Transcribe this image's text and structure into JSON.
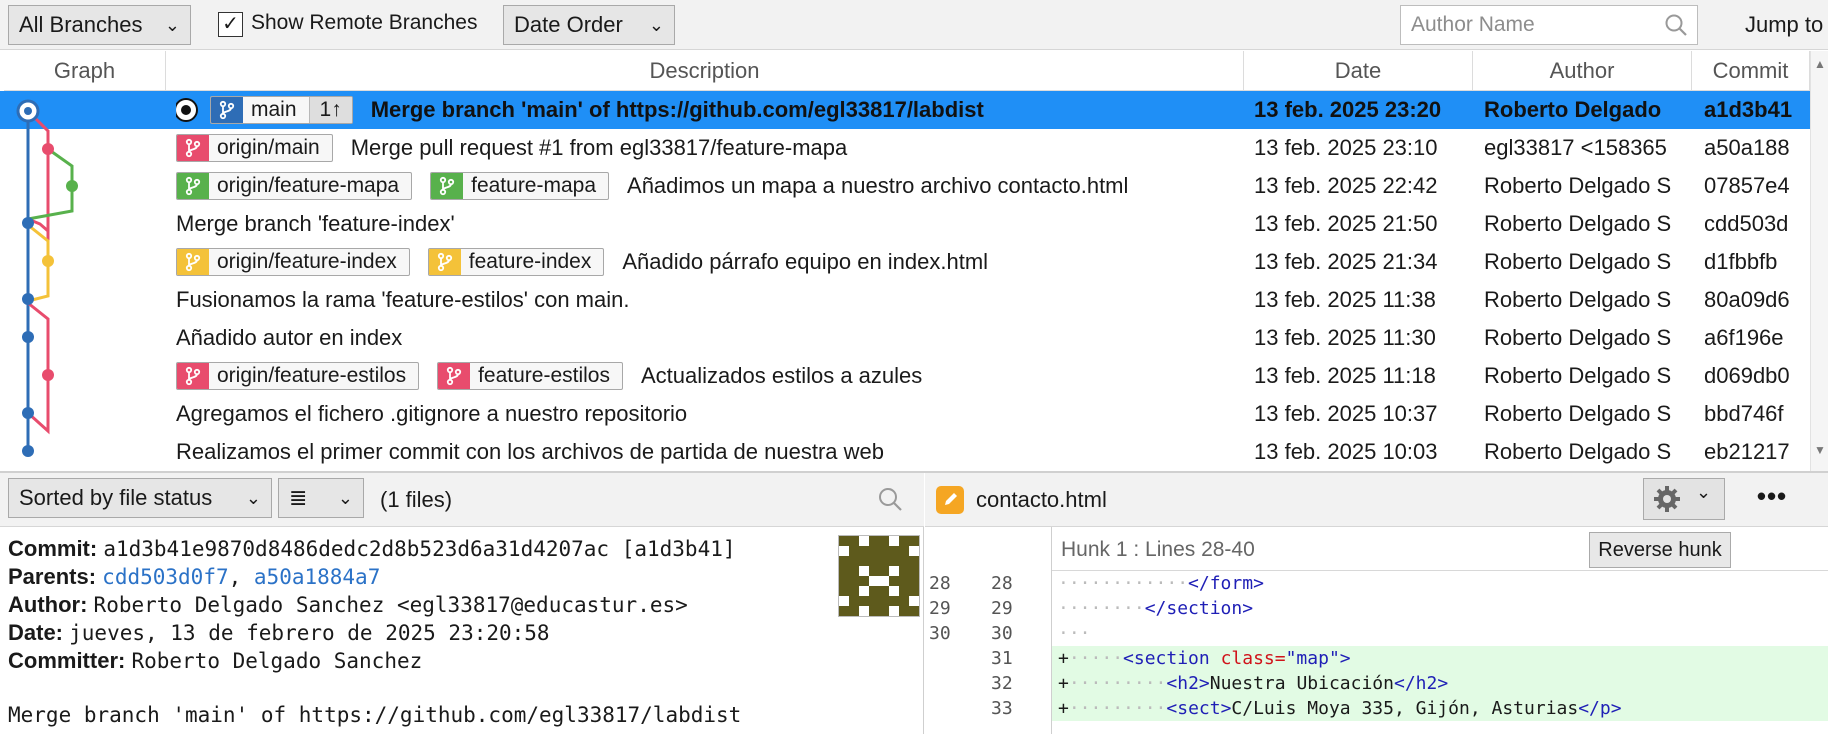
{
  "toolbar": {
    "branches_select": "All Branches",
    "show_remote_label": "Show Remote Branches",
    "show_remote_checked": "✓",
    "order_select": "Date Order",
    "author_search_placeholder": "Author Name",
    "jump_label": "Jump to"
  },
  "columns": {
    "graph": "Graph",
    "description": "Description",
    "date": "Date",
    "author": "Author",
    "commit": "Commit"
  },
  "commits": [
    {
      "badges": [
        {
          "label": "main",
          "color": "blue",
          "count": "1↑"
        }
      ],
      "message": "Merge branch 'main' of https://github.com/egl33817/labdist",
      "date": "13 feb. 2025 23:20",
      "author": "Roberto Delgado",
      "hash": "a1d3b41",
      "selected": true
    },
    {
      "badges": [
        {
          "label": "origin/main",
          "color": "red"
        }
      ],
      "message": "Merge pull request #1 from egl33817/feature-mapa",
      "date": "13 feb. 2025 23:10",
      "author": "egl33817 <158365",
      "hash": "a50a188"
    },
    {
      "badges": [
        {
          "label": "origin/feature-mapa",
          "color": "green"
        },
        {
          "label": "feature-mapa",
          "color": "green"
        }
      ],
      "message": "Añadimos un mapa a nuestro archivo contacto.html",
      "date": "13 feb. 2025 22:42",
      "author": "Roberto Delgado S",
      "hash": "07857e4"
    },
    {
      "badges": [],
      "message": "Merge branch 'feature-index'",
      "date": "13 feb. 2025 21:50",
      "author": "Roberto Delgado S",
      "hash": "cdd503d"
    },
    {
      "badges": [
        {
          "label": "origin/feature-index",
          "color": "yellow"
        },
        {
          "label": "feature-index",
          "color": "yellow"
        }
      ],
      "message": "Añadido párrafo equipo en index.html",
      "date": "13 feb. 2025 21:34",
      "author": "Roberto Delgado S",
      "hash": "d1fbbfb"
    },
    {
      "badges": [],
      "message": "Fusionamos la rama 'feature-estilos' con main.",
      "date": "13 feb. 2025 11:38",
      "author": "Roberto Delgado S",
      "hash": "80a09d6"
    },
    {
      "badges": [],
      "message": "Añadido autor en index",
      "date": "13 feb. 2025 11:30",
      "author": "Roberto Delgado S",
      "hash": "a6f196e"
    },
    {
      "badges": [
        {
          "label": "origin/feature-estilos",
          "color": "red"
        },
        {
          "label": "feature-estilos",
          "color": "red"
        }
      ],
      "message": "Actualizados estilos a azules",
      "date": "13 feb. 2025 11:18",
      "author": "Roberto Delgado S",
      "hash": "d069db0"
    },
    {
      "badges": [],
      "message": "Agregamos el fichero .gitignore a nuestro repositorio",
      "date": "13 feb. 2025 10:37",
      "author": "Roberto Delgado S",
      "hash": "bbd746f"
    },
    {
      "badges": [],
      "message": "Realizamos el primer commit con los archivos de partida de nuestra web",
      "date": "13 feb. 2025 10:03",
      "author": "Roberto Delgado S",
      "hash": "eb21217"
    }
  ],
  "file_pane": {
    "sort_select": "Sorted by file status",
    "view_select": "≣",
    "files_count": "(1 files)"
  },
  "details": {
    "commit_label": "Commit:",
    "commit_value": "a1d3b41e9870d8486dedc2d8b523d6a31d4207ac [a1d3b41]",
    "parents_label": "Parents:",
    "parent_1": "cdd503d0f7",
    "parents_sep": ", ",
    "parent_2": "a50a1884a7",
    "author_label": "Author:",
    "author_value": "Roberto Delgado Sanchez <egl33817@educastur.es>",
    "date_label": "Date:",
    "date_value": "jueves, 13 de febrero de 2025 23:20:58",
    "committer_label": "Committer:",
    "committer_value": "Roberto Delgado Sanchez",
    "message": "Merge branch 'main' of https://github.com/egl33817/labdist"
  },
  "diff": {
    "file_name": "contacto.html",
    "more_label": "•••",
    "hunk_title": "Hunk 1 : Lines 28-40",
    "reverse_label": "Reverse hunk",
    "lines": [
      {
        "old": "28",
        "new": "28",
        "type": "ctx",
        "prefix": "",
        "indent": "············",
        "tag_open": "</form>",
        "attr": "",
        "attr_value": "",
        "text": "",
        "tag_close": ""
      },
      {
        "old": "29",
        "new": "29",
        "type": "ctx",
        "prefix": "",
        "indent": "········",
        "tag_open": "</section>",
        "attr": "",
        "attr_value": "",
        "text": "",
        "tag_close": ""
      },
      {
        "old": "30",
        "new": "30",
        "type": "ctx",
        "prefix": "",
        "indent": "···",
        "tag_open": "",
        "attr": "",
        "attr_value": "",
        "text": "",
        "tag_close": ""
      },
      {
        "old": "",
        "new": "31",
        "type": "add",
        "prefix": "+",
        "indent": "·····",
        "tag_open": "<section",
        "attr": " class=",
        "attr_value": "\"map\"",
        "text": ">",
        "tag_close": ""
      },
      {
        "old": "",
        "new": "32",
        "type": "add",
        "prefix": "+",
        "indent": "·········",
        "tag_open": "<h2>",
        "attr": "",
        "attr_value": "",
        "text": "Nuestra Ubicación",
        "tag_close": "</h2>"
      },
      {
        "old": "",
        "new": "33",
        "type": "add",
        "prefix": "+",
        "indent": "·········",
        "tag_open": "<sect>",
        "attr": "",
        "attr_value": "",
        "text": "C/Luis Moya 335, Gijón, Asturias",
        "tag_close": "</p>"
      }
    ]
  },
  "colors": {
    "selection": "#1f8ff6",
    "branch_blue": "#2e6db6",
    "branch_red": "#e84c6d",
    "branch_green": "#58b14c",
    "branch_yellow": "#f4c239",
    "added_line_bg": "#e2fbe4"
  }
}
